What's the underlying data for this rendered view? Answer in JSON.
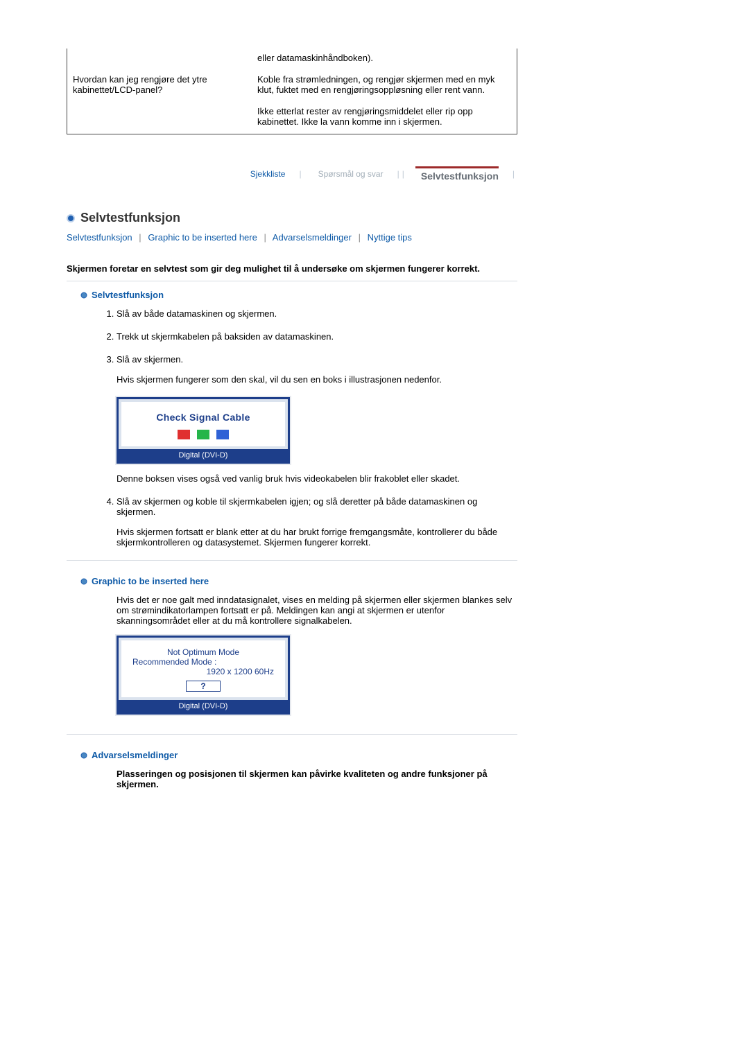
{
  "qa": {
    "prev_answer_tail": "eller datamaskinhåndboken).",
    "q2": "Hvordan kan jeg rengjøre det ytre kabinettet/LCD-panel?",
    "a2_p1": "Koble fra strømledningen, og rengjør skjermen med en myk klut, fuktet med en rengjøringsoppløsning eller rent vann.",
    "a2_p2": "Ikke etterlat rester av rengjøringsmiddelet eller rip opp kabinettet. Ikke la vann komme inn i skjermen."
  },
  "tabs": {
    "t1": "Sjekkliste",
    "t2": "Spørsmål og svar",
    "t3": "Selvtestfunksjon"
  },
  "section": {
    "title": "Selvtestfunksjon",
    "links": {
      "l1": "Selvtestfunksjon",
      "l2": "Graphic to be inserted here",
      "l3": "Advarselsmeldinger",
      "l4": "Nyttige tips"
    },
    "intro": "Skjermen foretar en selvtest som gir deg mulighet til å undersøke om skjermen fungerer korrekt."
  },
  "selftest": {
    "heading": "Selvtestfunksjon",
    "steps": {
      "s1": "Slå av både datamaskinen og skjermen.",
      "s2": "Trekk ut skjermkabelen på baksiden av datamaskinen.",
      "s3": "Slå av skjermen.",
      "s3p": "Hvis skjermen fungerer som den skal, vil du sen en boks i illustrasjonen nedenfor.",
      "img1_title": "Check Signal Cable",
      "img1_footer": "Digital (DVI-D)",
      "s3after": "Denne boksen vises også ved vanlig bruk hvis videokabelen blir frakoblet eller skadet.",
      "s4": "Slå av skjermen og koble til skjermkabelen igjen; og slå deretter på både datamaskinen og skjermen.",
      "s4p": "Hvis skjermen fortsatt er blank etter at du har brukt forrige fremgangsmåte, kontrollerer du både skjermkontrolleren og datasystemet. Skjermen fungerer korrekt."
    }
  },
  "graphic": {
    "heading": "Graphic to be inserted here",
    "para": "Hvis det er noe galt med inndatasignalet, vises en melding på skjermen eller skjermen blankes selv om strømindikatorlampen fortsatt er på. Meldingen kan angi at skjermen er utenfor skanningsområdet eller at du må kontrollere signalkabelen.",
    "img2_l1": "Not Optimum Mode",
    "img2_l2": "Recommended Mode :",
    "img2_l3": "1920 x 1200 60Hz",
    "img2_q": "?",
    "img2_footer": "Digital (DVI-D)"
  },
  "warnings": {
    "heading": "Advarselsmeldinger",
    "para": "Plasseringen og posisjonen til skjermen kan påvirke kvaliteten og andre funksjoner på skjermen."
  }
}
